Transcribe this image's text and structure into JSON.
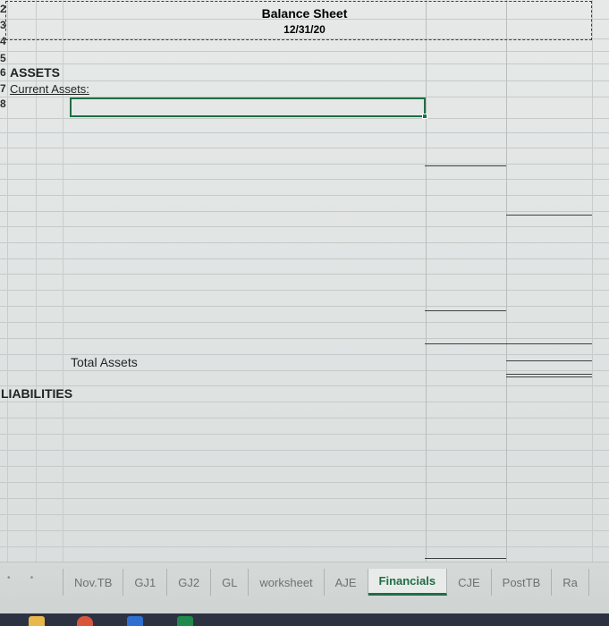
{
  "sheet": {
    "title": "Balance Sheet",
    "date": "12/31/20",
    "row_numbers": [
      "2",
      "3",
      "4",
      "5",
      "6",
      "7",
      "8"
    ],
    "assets_heading": "ASSETS",
    "current_assets_label": "Current Assets:",
    "total_assets_label": "Total Assets",
    "liabilities_heading": "LIABILITIES"
  },
  "tabs": [
    {
      "label": "Nov.TB",
      "active": false
    },
    {
      "label": "GJ1",
      "active": false
    },
    {
      "label": "GJ2",
      "active": false
    },
    {
      "label": "GL",
      "active": false
    },
    {
      "label": "worksheet",
      "active": false
    },
    {
      "label": "AJE",
      "active": false
    },
    {
      "label": "Financials",
      "active": true
    },
    {
      "label": "CJE",
      "active": false
    },
    {
      "label": "PostTB",
      "active": false
    },
    {
      "label": "Ra",
      "active": false
    }
  ],
  "colors": {
    "accent": "#1f6e43",
    "taskbar": "#2d3243"
  }
}
